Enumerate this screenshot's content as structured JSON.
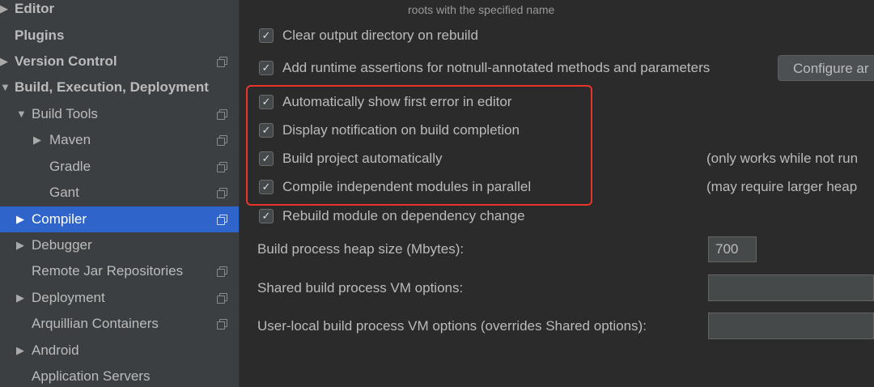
{
  "sidebar": {
    "items": [
      {
        "label": "Editor",
        "arrow": "▶",
        "bold": true
      },
      {
        "label": "Plugins",
        "arrow": "",
        "bold": true
      },
      {
        "label": "Version Control",
        "arrow": "▶",
        "bold": true
      },
      {
        "label": "Build, Execution, Deployment",
        "arrow": "▼",
        "bold": true
      },
      {
        "label": "Build Tools",
        "arrow": "▼"
      },
      {
        "label": "Maven",
        "arrow": "▶"
      },
      {
        "label": "Gradle",
        "arrow": ""
      },
      {
        "label": "Gant",
        "arrow": ""
      },
      {
        "label": "Compiler",
        "arrow": "▶",
        "selected": true
      },
      {
        "label": "Debugger",
        "arrow": "▶"
      },
      {
        "label": "Remote Jar Repositories",
        "arrow": ""
      },
      {
        "label": "Deployment",
        "arrow": "▶"
      },
      {
        "label": "Arquillian Containers",
        "arrow": ""
      },
      {
        "label": "Android",
        "arrow": "▶"
      },
      {
        "label": "Application Servers",
        "arrow": ""
      }
    ]
  },
  "compiler": {
    "hint_top": "roots with the specified name",
    "checkbox_glyph": "✓",
    "options": [
      {
        "label": "Clear output directory on rebuild",
        "checked": true
      },
      {
        "label": "Add runtime assertions for notnull-annotated methods and parameters",
        "checked": true
      },
      {
        "label": "Automatically show first error in editor",
        "checked": true
      },
      {
        "label": "Display notification on build completion",
        "checked": true
      },
      {
        "label": "Build project automatically",
        "checked": true
      },
      {
        "label": "Compile independent modules in parallel",
        "checked": true
      },
      {
        "label": "Rebuild module on dependency change",
        "checked": true
      }
    ],
    "configure_button": "Configure ar",
    "notes": {
      "build_auto": "(only works while not run",
      "parallel": "(may require larger heap"
    },
    "heap_label": "Build process heap size (Mbytes):",
    "heap_value": "700",
    "shared_vm_label": "Shared build process VM options:",
    "shared_vm_value": "",
    "user_vm_label": "User-local build process VM options (overrides Shared options):",
    "user_vm_value": ""
  },
  "colors": {
    "highlight_border": "#e8352c",
    "selection": "#2f65ca"
  }
}
